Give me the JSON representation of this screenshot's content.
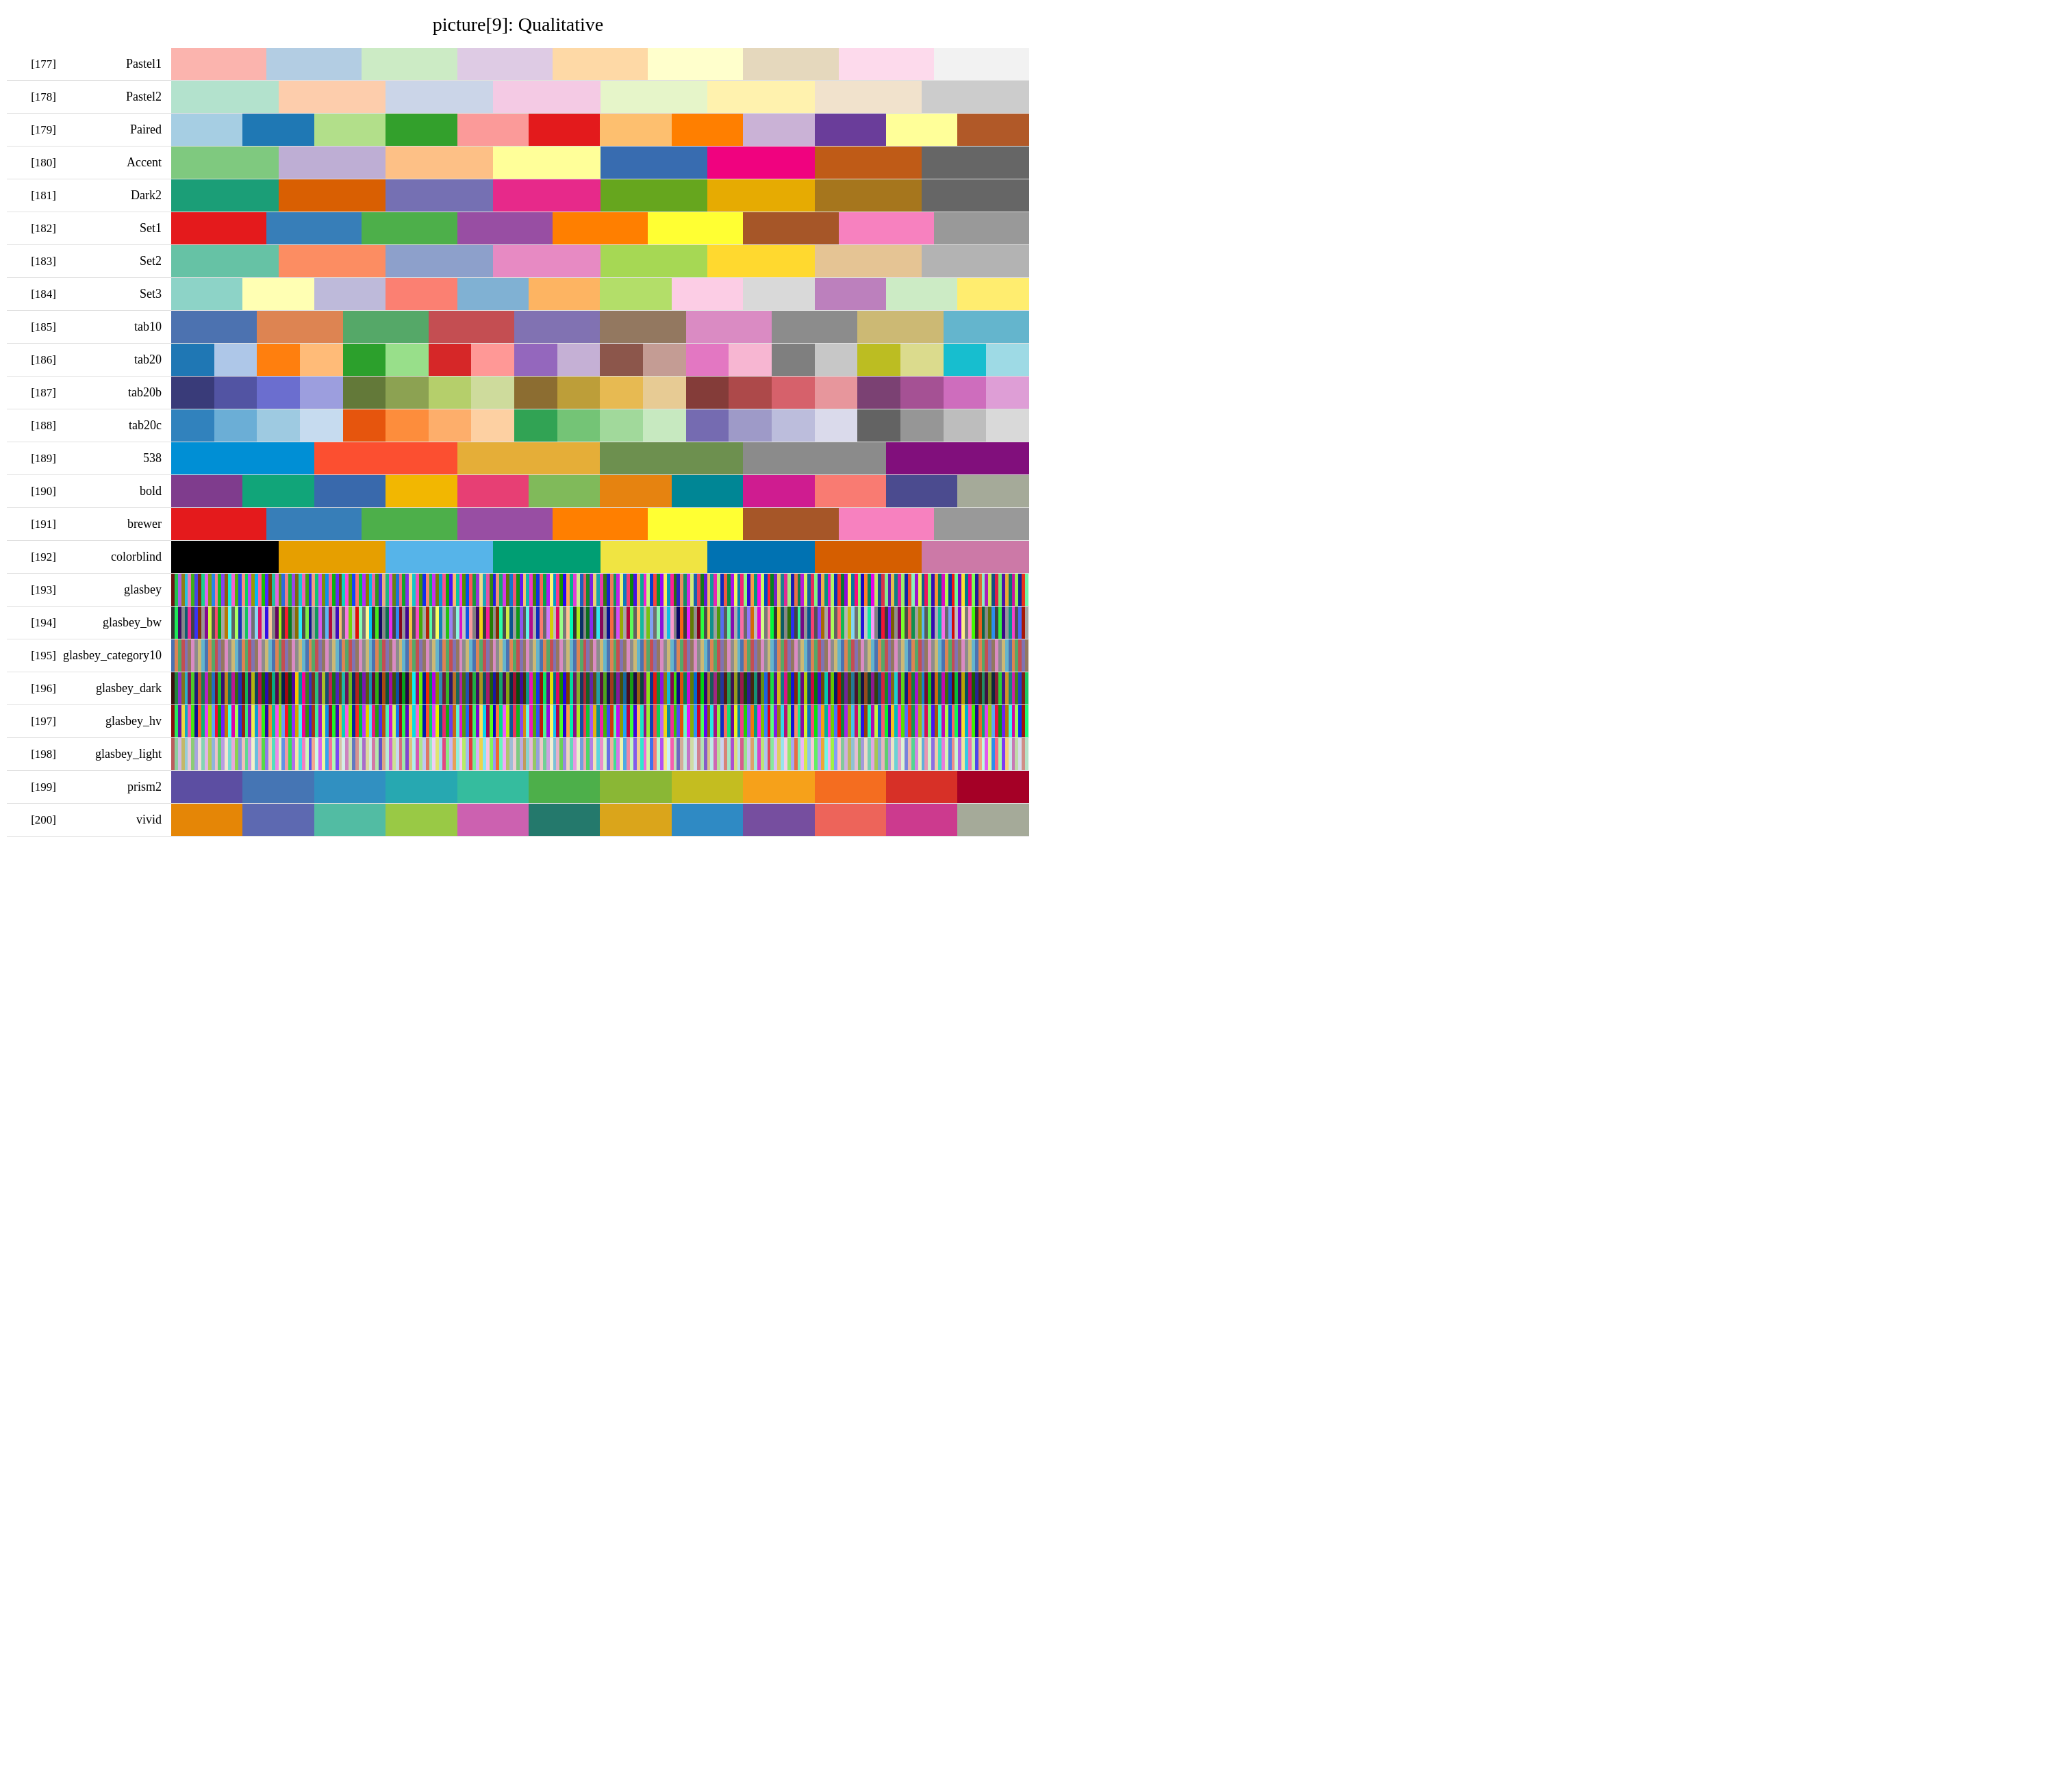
{
  "title": "picture[9]:  Qualitative",
  "rows": [
    {
      "index": "[177]",
      "name": "Pastel1",
      "type": "fixed",
      "colors": [
        "#fbb4ae",
        "#b3cde3",
        "#ccebc5",
        "#decbe4",
        "#fed9a6",
        "#ffffcc",
        "#e5d8bd",
        "#fddaec",
        "#f2f2f2"
      ]
    },
    {
      "index": "[178]",
      "name": "Pastel2",
      "type": "fixed",
      "colors": [
        "#b3e2cd",
        "#fdcdac",
        "#cbd5e8",
        "#f4cae4",
        "#e6f5c9",
        "#fff2ae",
        "#f1e2cc",
        "#cccccc"
      ]
    },
    {
      "index": "[179]",
      "name": "Paired",
      "type": "fixed",
      "colors": [
        "#a6cee3",
        "#1f78b4",
        "#b2df8a",
        "#33a02c",
        "#fb9a99",
        "#e31a1c",
        "#fdbf6f",
        "#ff7f00",
        "#cab2d6",
        "#6a3d9a",
        "#ffff99",
        "#b15928"
      ]
    },
    {
      "index": "[180]",
      "name": "Accent",
      "type": "fixed",
      "colors": [
        "#7fc97f",
        "#beaed4",
        "#fdc086",
        "#ffff99",
        "#386cb0",
        "#f0027f",
        "#bf5b17",
        "#666666"
      ]
    },
    {
      "index": "[181]",
      "name": "Dark2",
      "type": "fixed",
      "colors": [
        "#1b9e77",
        "#d95f02",
        "#7570b3",
        "#e7298a",
        "#66a61e",
        "#e6ab02",
        "#a6761d",
        "#666666"
      ]
    },
    {
      "index": "[182]",
      "name": "Set1",
      "type": "fixed",
      "colors": [
        "#e41a1c",
        "#377eb8",
        "#4daf4a",
        "#984ea3",
        "#ff7f00",
        "#ffff33",
        "#a65628",
        "#f781bf",
        "#999999"
      ]
    },
    {
      "index": "[183]",
      "name": "Set2",
      "type": "fixed",
      "colors": [
        "#66c2a5",
        "#fc8d62",
        "#8da0cb",
        "#e78ac3",
        "#a6d854",
        "#ffd92f",
        "#e5c494",
        "#b3b3b3"
      ]
    },
    {
      "index": "[184]",
      "name": "Set3",
      "type": "fixed",
      "colors": [
        "#8dd3c7",
        "#ffffb3",
        "#bebada",
        "#fb8072",
        "#80b1d3",
        "#fdb462",
        "#b3de69",
        "#fccde5",
        "#d9d9d9",
        "#bc80bd",
        "#ccebc5",
        "#ffed6f"
      ]
    },
    {
      "index": "[185]",
      "name": "tab10",
      "type": "fixed",
      "colors": [
        "#4c72b0",
        "#dd8452",
        "#55a868",
        "#c44e52",
        "#8172b2",
        "#937860",
        "#da8bc3",
        "#8c8c8c",
        "#ccb974",
        "#64b5cd"
      ]
    },
    {
      "index": "[186]",
      "name": "tab20",
      "type": "fixed",
      "colors": [
        "#1f77b4",
        "#aec7e8",
        "#ff7f0e",
        "#ffbb78",
        "#2ca02c",
        "#98df8a",
        "#d62728",
        "#ff9896",
        "#9467bd",
        "#c5b0d5",
        "#8c564b",
        "#c49c94",
        "#e377c2",
        "#f7b6d2",
        "#7f7f7f",
        "#c7c7c7",
        "#bcbd22",
        "#dbdb8d",
        "#17becf",
        "#9edae5"
      ]
    },
    {
      "index": "[187]",
      "name": "tab20b",
      "type": "fixed",
      "colors": [
        "#393b79",
        "#5254a3",
        "#6b6ecf",
        "#9c9ede",
        "#637939",
        "#8ca252",
        "#b5cf6b",
        "#cedb9c",
        "#8c6d31",
        "#bd9e39",
        "#e7ba52",
        "#e7cb94",
        "#843c39",
        "#ad494a",
        "#d6616b",
        "#e7969c",
        "#7b4173",
        "#a55194",
        "#ce6dbd",
        "#de9ed6"
      ]
    },
    {
      "index": "[188]",
      "name": "tab20c",
      "type": "fixed",
      "colors": [
        "#3182bd",
        "#6baed6",
        "#9ecae1",
        "#c6dbef",
        "#e6550d",
        "#fd8d3c",
        "#fdae6b",
        "#fdd0a2",
        "#31a354",
        "#74c476",
        "#a1d99b",
        "#c7e9c0",
        "#756bb1",
        "#9e9ac8",
        "#bcbddc",
        "#dadaeb",
        "#636363",
        "#969696",
        "#bdbdbd",
        "#d9d9d9"
      ]
    },
    {
      "index": "[189]",
      "name": "538",
      "type": "fixed",
      "colors": [
        "#008fd5",
        "#fc4f30",
        "#e5ae38",
        "#6d904f",
        "#8b8b8b",
        "#810f7c"
      ]
    },
    {
      "index": "[190]",
      "name": "bold",
      "type": "fixed",
      "colors": [
        "#7f3c8d",
        "#11a579",
        "#3969ac",
        "#f2b701",
        "#e73f74",
        "#80ba5a",
        "#e68310",
        "#008695",
        "#cf1c90",
        "#f97b72",
        "#4b4b8f",
        "#a5aa99"
      ]
    },
    {
      "index": "[191]",
      "name": "brewer",
      "type": "fixed",
      "colors": [
        "#e41a1c",
        "#377eb8",
        "#4daf4a",
        "#984ea3",
        "#ff7f00",
        "#ffff33",
        "#a65628",
        "#f781bf",
        "#999999"
      ]
    },
    {
      "index": "[192]",
      "name": "colorblind",
      "type": "fixed",
      "colors": [
        "#000000",
        "#e69f00",
        "#56b4e9",
        "#009e73",
        "#f0e442",
        "#0072b2",
        "#d55e00",
        "#cc79a7"
      ]
    },
    {
      "index": "[193]",
      "name": "glasbey",
      "type": "dense"
    },
    {
      "index": "[194]",
      "name": "glasbey_bw",
      "type": "dense"
    },
    {
      "index": "[195]",
      "name": "glasbey_category10",
      "type": "dense"
    },
    {
      "index": "[196]",
      "name": "glasbey_dark",
      "type": "dense"
    },
    {
      "index": "[197]",
      "name": "glasbey_hv",
      "type": "dense"
    },
    {
      "index": "[198]",
      "name": "glasbey_light",
      "type": "dense"
    },
    {
      "index": "[199]",
      "name": "prism2",
      "type": "fixed",
      "colors": [
        "#5c4ea2",
        "#4575b4",
        "#3190c1",
        "#27a8b1",
        "#35bc9e",
        "#4daf4a",
        "#8ab735",
        "#c4bd20",
        "#f6a11a",
        "#f46d20",
        "#d73027",
        "#a50026"
      ]
    },
    {
      "index": "[200]",
      "name": "vivid",
      "type": "fixed",
      "colors": [
        "#e58606",
        "#5d69b1",
        "#52bca3",
        "#99c945",
        "#cc61b0",
        "#24796c",
        "#daa51b",
        "#2f8ac4",
        "#764e9f",
        "#ed645a",
        "#cc3a8e",
        "#a5aa99"
      ]
    }
  ]
}
